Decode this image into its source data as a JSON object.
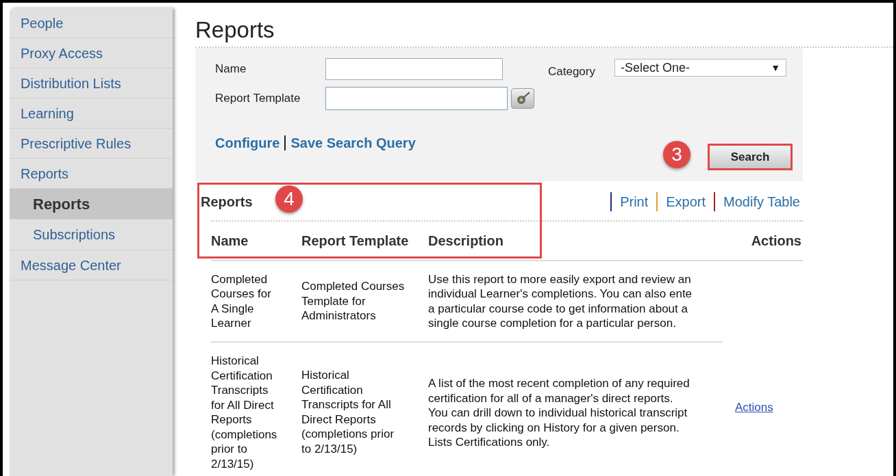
{
  "sidebar": {
    "items": [
      {
        "label": "People",
        "selected": false
      },
      {
        "label": "Proxy Access",
        "selected": false
      },
      {
        "label": "Distribution Lists",
        "selected": false
      },
      {
        "label": "Learning",
        "selected": false
      },
      {
        "label": "Prescriptive Rules",
        "selected": false
      },
      {
        "label": "Reports",
        "selected": false,
        "children": [
          {
            "label": "Reports",
            "selected": true
          },
          {
            "label": "Subscriptions",
            "selected": false
          }
        ]
      },
      {
        "label": "Message Center",
        "selected": false
      }
    ]
  },
  "page_title": "Reports",
  "search_form": {
    "name_label": "Name",
    "template_label": "Report Template",
    "category_label": "Category",
    "category_value": "-Select One-",
    "dropdown_arrow": "▼",
    "links": [
      "Configure",
      "Save Search Query"
    ],
    "search_button": "Search",
    "step_badge": "3"
  },
  "results": {
    "title": "Reports",
    "step_badge": "4",
    "links": [
      "Print",
      "Export",
      "Modify Table"
    ],
    "columns": [
      "Name",
      "Report Template",
      "Description",
      "Actions"
    ],
    "rows": [
      {
        "name": [
          "Completed",
          "Courses for",
          "A Single",
          "Learner"
        ],
        "template": [
          "Completed Courses",
          "Template for",
          "Administrators"
        ],
        "description": [
          "Use this report to more easily export and review an",
          "individual Learner's completions. You can also ente",
          "a particular course code to get information about a",
          "single course completion for a particular person."
        ]
      },
      {
        "name": [
          "Historical",
          "Certification",
          "Transcripts",
          "for All Direct",
          "Reports",
          "(completions",
          "prior to",
          "2/13/15)"
        ],
        "template": [
          "Historical",
          "Certification",
          "Transcripts for All",
          "Direct Reports",
          "(completions prior",
          "to 2/13/15)"
        ],
        "description": [
          "A list of the most recent completion of any required",
          "certification for all of a manager's direct reports.",
          "You can drill down to individual historical transcript",
          "records by clicking on History for a given person.",
          "Lists Certifications only."
        ],
        "action": "Actions"
      }
    ]
  }
}
